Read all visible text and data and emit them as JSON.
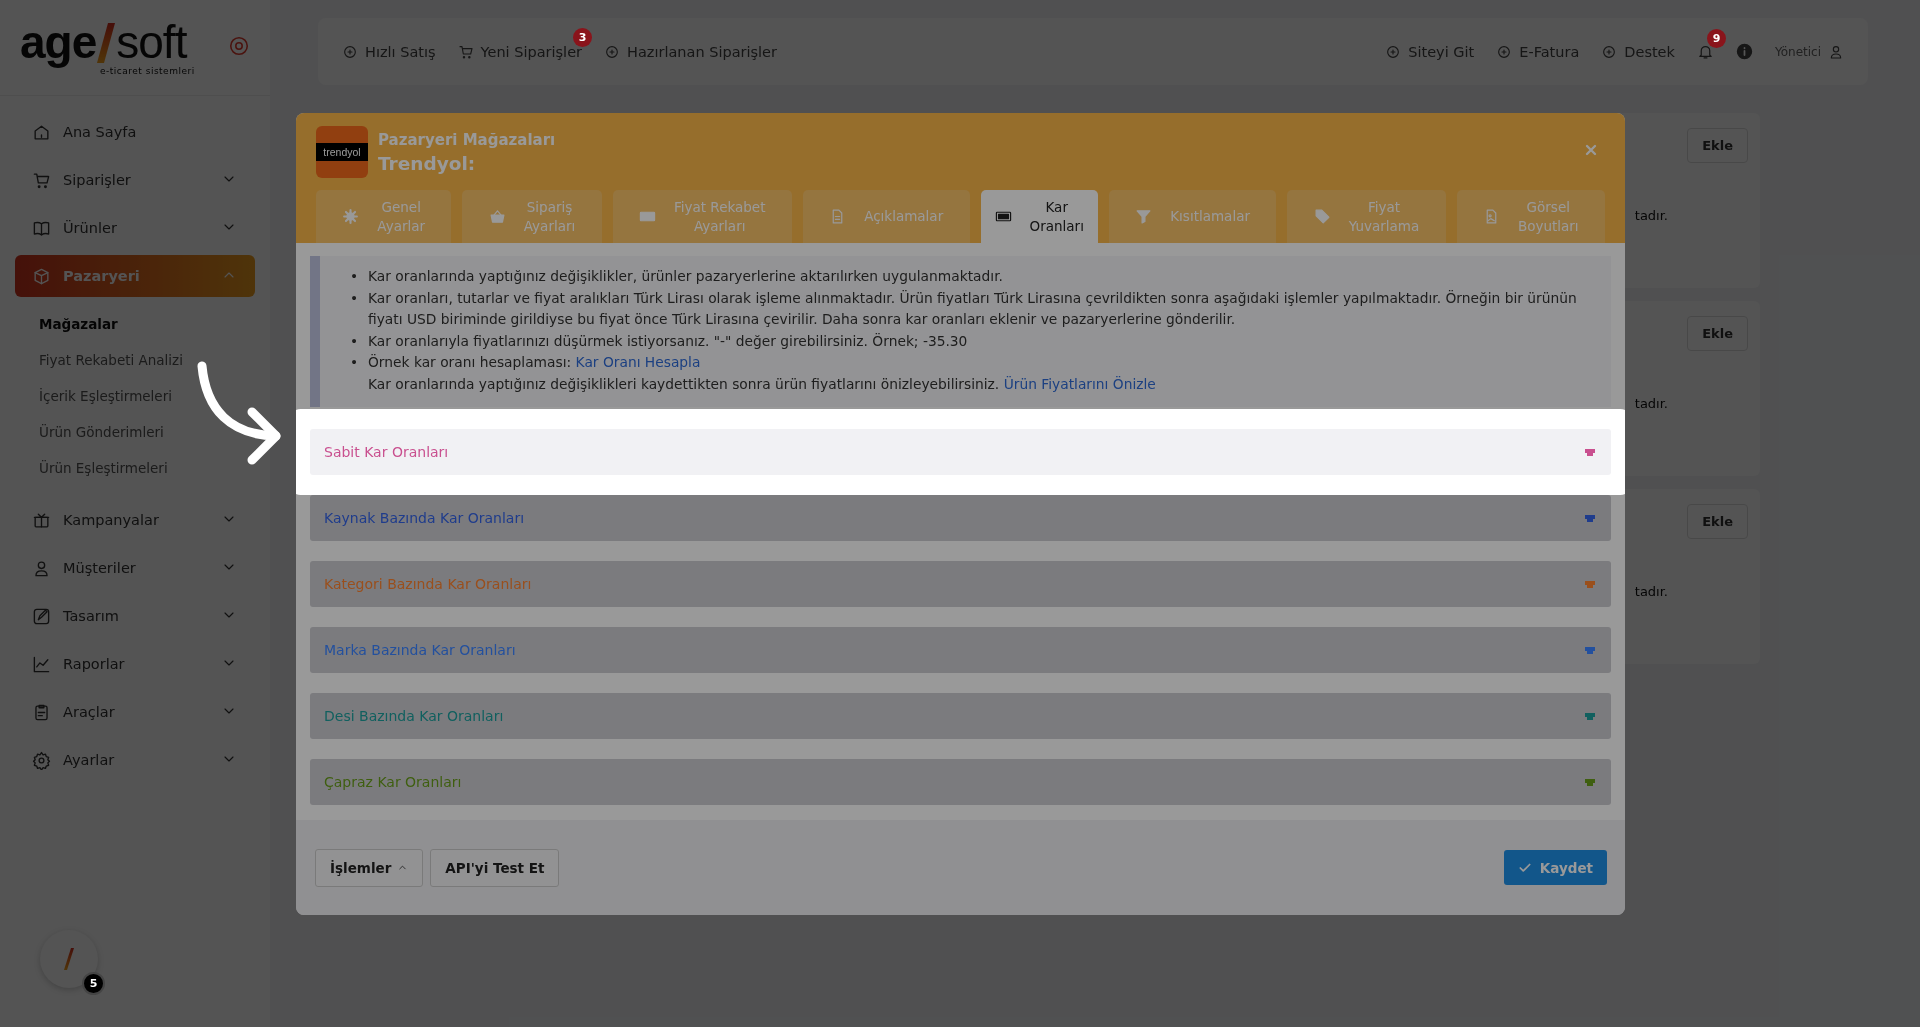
{
  "sidebar": {
    "logo": {
      "left": "age",
      "right": "soft",
      "tagline": "e-ticaret sistemleri"
    },
    "items": [
      {
        "label": "Ana Sayfa",
        "kind": "link",
        "selected": false
      },
      {
        "label": "Siparişler",
        "kind": "group",
        "selected": false,
        "expanded": false
      },
      {
        "label": "Ürünler",
        "kind": "group",
        "selected": false,
        "expanded": false
      },
      {
        "label": "Pazaryeri",
        "kind": "group",
        "selected": true,
        "expanded": true,
        "children": [
          {
            "label": "Mağazalar",
            "selected": true
          },
          {
            "label": "Fiyat Rekabeti Analizi",
            "selected": false
          },
          {
            "label": "İçerik Eşleştirmeleri",
            "selected": false
          },
          {
            "label": "Ürün Gönderimleri",
            "selected": false
          },
          {
            "label": "Ürün Eşleştirmeleri",
            "selected": false
          }
        ]
      },
      {
        "label": "Kampanyalar",
        "kind": "group",
        "selected": false,
        "expanded": false
      },
      {
        "label": "Müşteriler",
        "kind": "group",
        "selected": false,
        "expanded": false
      },
      {
        "label": "Tasarım",
        "kind": "group",
        "selected": false,
        "expanded": false
      },
      {
        "label": "Raporlar",
        "kind": "group",
        "selected": false,
        "expanded": false
      },
      {
        "label": "Araçlar",
        "kind": "group",
        "selected": false,
        "expanded": false
      },
      {
        "label": "Ayarlar",
        "kind": "group",
        "selected": false,
        "expanded": false
      }
    ]
  },
  "floating_button": {
    "badge": "5"
  },
  "topbar": {
    "left": [
      {
        "label": "Hızlı Satış"
      },
      {
        "label": "Yeni Siparişler",
        "badge": "3"
      },
      {
        "label": "Hazırlanan Siparişler"
      }
    ],
    "right": [
      {
        "label": "Siteyi Git"
      },
      {
        "label": "E-Fatura"
      },
      {
        "label": "Destek"
      }
    ],
    "notifications_badge": "9",
    "user": "Yönetici"
  },
  "background_cards": [
    {
      "button": "Ekle",
      "text": "tadır."
    },
    {
      "button": "Ekle",
      "text": "tadır."
    },
    {
      "button": "Ekle",
      "text": "tadır."
    }
  ],
  "modal": {
    "title": "Pazaryeri Mağazaları",
    "subtitle": "Trendyol:",
    "logo_text": "trendyol",
    "tabs": [
      {
        "label": "Genel\nAyarlar",
        "selected": false
      },
      {
        "label": "Sipariş\nAyarları",
        "selected": false
      },
      {
        "label": "Fiyat Rekabet\nAyarları",
        "selected": false
      },
      {
        "label": "Açıklamalar",
        "selected": false
      },
      {
        "label": "Kar\nOranları",
        "selected": true
      },
      {
        "label": "Kısıtlamalar",
        "selected": false
      },
      {
        "label": "Fiyat\nYuvarlama",
        "selected": false
      },
      {
        "label": "Görsel\nBoyutları",
        "selected": false
      }
    ],
    "info": [
      {
        "bullet": "•",
        "text": "Kar oranlarında yaptığınız değişiklikler, ürünler pazaryerlerine aktarılırken uygulanmaktadır."
      },
      {
        "bullet": "•",
        "text": "Kar oranları, tutarlar ve fiyat aralıkları Türk Lirası olarak işleme alınmaktadır. Ürün fiyatları Türk Lirasına çevrildikten sonra aşağıdaki işlemler yapılmaktadır. Örneğin bir ürünün fiyatı USD biriminde girildiyse bu fiyat önce Türk Lirasına çevirilir. Daha sonra kar oranları eklenir ve pazaryerlerine gönderilir."
      },
      {
        "bullet": "•",
        "text": "Kar oranlarıyla fiyatlarınızı düşürmek istiyorsanız. \"-\" değer girebilirsiniz. Örnek; -35.30"
      },
      {
        "bullet": "•",
        "text": "Örnek kar oranı hesaplaması:",
        "link": "Kar Oranı Hesapla",
        "note": "Kar oranlarında yaptığınız değişiklikleri kaydettikten sonra ürün fiyatlarını önizleyebilirsiniz.",
        "note_link": "Ürün Fiyatlarını Önizle"
      }
    ],
    "sections": [
      {
        "title": "Sabit Kar Oranları",
        "color": "#c9508f",
        "highlighted": true
      },
      {
        "title": "Kaynak Bazında Kar Oranları",
        "color": "#1f3c8c",
        "highlighted": false
      },
      {
        "title": "Kategori Bazında Kar Oranları",
        "color": "#9a4f1c",
        "highlighted": false
      },
      {
        "title": "Marka Bazında Kar Oranları",
        "color": "#23509e",
        "highlighted": false
      },
      {
        "title": "Desi Bazında Kar Oranları",
        "color": "#11605f",
        "highlighted": false
      },
      {
        "title": "Çapraz Kar Oranları",
        "color": "#3f5f10",
        "highlighted": false
      }
    ],
    "footer": {
      "buttons": [
        {
          "label": "İşlemler",
          "kind": "menu"
        },
        {
          "label": "API'yi Test Et",
          "kind": "plain"
        }
      ],
      "save": "Kaydet"
    }
  }
}
